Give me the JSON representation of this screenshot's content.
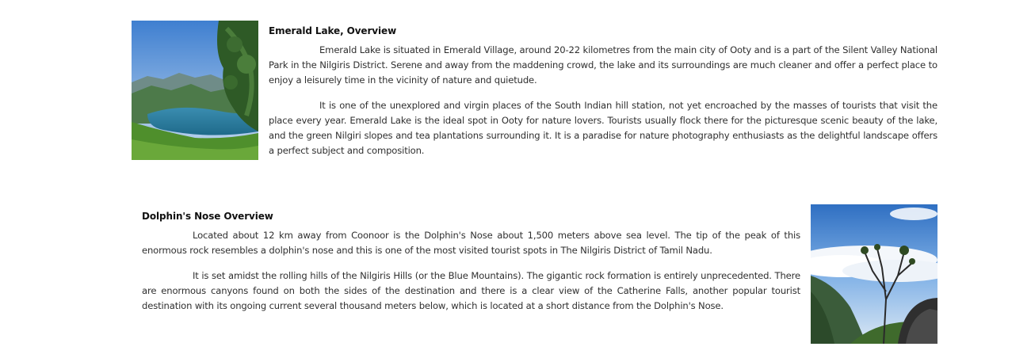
{
  "sections": [
    {
      "heading": "Emerald Lake, Overview",
      "paragraphs": [
        "Emerald Lake is situated in Emerald Village, around 20-22 kilometres from the main city of Ooty and is a part of the Silent Valley National Park in the Nilgiris District. Serene and away from the maddening crowd, the lake and its surroundings are much cleaner and offer a perfect place to enjoy a leisurely time in the vicinity of nature and quietude.",
        "It is one of the unexplored and virgin places of the South Indian hill station, not yet encroached by the masses of tourists that visit the place every year. Emerald Lake is the ideal spot in Ooty for nature lovers. Tourists usually flock there for the picturesque scenic beauty of the lake, and the green Nilgiri slopes and tea plantations surrounding it. It is a paradise for nature photography enthusiasts as the delightful landscape offers a perfect subject and composition."
      ],
      "image": "emerald-lake-photo"
    },
    {
      "heading": "Dolphin's Nose Overview",
      "paragraphs": [
        "Located about 12 km away from Coonoor is the Dolphin's Nose about 1,500 meters above sea level. The tip of the peak of this enormous rock resembles a dolphin's nose and this is one of the most visited tourist spots in The Nilgiris District of Tamil Nadu.",
        "It is set amidst the rolling hills of the Nilgiris Hills (or the Blue Mountains). The gigantic rock formation is entirely unprecedented. There are enormous canyons found on both the sides of the destination and there is a clear view of the Catherine Falls, another popular tourist destination with its ongoing current several thousand meters below, which is located at a short distance from the Dolphin's Nose."
      ],
      "image": "dolphins-nose-photo"
    }
  ]
}
